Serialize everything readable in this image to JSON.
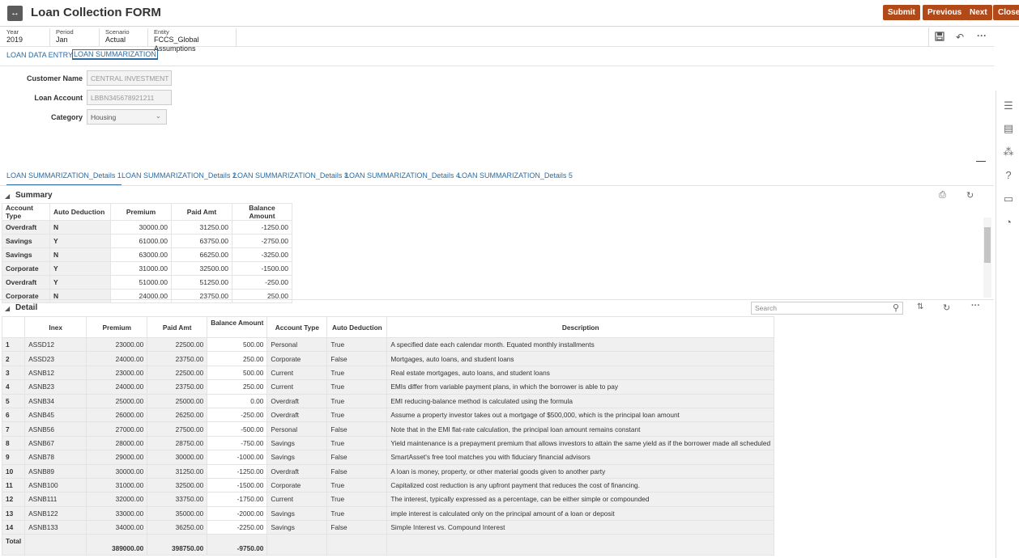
{
  "header": {
    "title": "Loan Collection FORM",
    "buttons": [
      "Submit",
      "Previous",
      "Next",
      "Close"
    ],
    "accent": "#b14a18"
  },
  "pov": [
    {
      "label": "Year",
      "value": "2019"
    },
    {
      "label": "Period",
      "value": "Jan"
    },
    {
      "label": "Scenario",
      "value": "Actual"
    },
    {
      "label": "Entity",
      "value": "FCCS_Global Assumptions"
    }
  ],
  "tabs": [
    "LOAN DATA ENTRY",
    "LOAN SUMMARIZATION"
  ],
  "form": {
    "customer_name_label": "Customer Name",
    "customer_name_value": "CENTRAL INVESTMENT E",
    "loan_account_label": "Loan Account",
    "loan_account_value": "LBBN345678921211",
    "category_label": "Category",
    "category_value": "Housing"
  },
  "subtabs": [
    "LOAN SUMMARIZATION_Details 1",
    "LOAN SUMMARIZATION_Details 2",
    "LOAN SUMMARIZATION_Details 3",
    "LOAN SUMMARIZATION_Details 4",
    "LOAN SUMMARIZATION_Details 5"
  ],
  "summary": {
    "title": "Summary",
    "headers": [
      "Account Type",
      "Auto Deduction",
      "Premium",
      "Paid Amt",
      "Balance Amount"
    ],
    "rows": [
      [
        "Overdraft",
        "N",
        "30000.00",
        "31250.00",
        "-1250.00"
      ],
      [
        "Savings",
        "Y",
        "61000.00",
        "63750.00",
        "-2750.00"
      ],
      [
        "Savings",
        "N",
        "63000.00",
        "66250.00",
        "-3250.00"
      ],
      [
        "Corporate",
        "Y",
        "31000.00",
        "32500.00",
        "-1500.00"
      ],
      [
        "Overdraft",
        "Y",
        "51000.00",
        "51250.00",
        "-250.00"
      ],
      [
        "Corporate",
        "N",
        "24000.00",
        "23750.00",
        "250.00"
      ]
    ]
  },
  "detail": {
    "title": "Detail",
    "search_placeholder": "Search",
    "headers": [
      "Inex",
      "Premium",
      "Paid Amt",
      "Balance Amount",
      "Account Type",
      "Auto Deduction",
      "Description"
    ],
    "rows": [
      [
        "1",
        "ASSD12",
        "23000.00",
        "22500.00",
        "500.00",
        "Personal",
        "True",
        "A specified date each calendar month. Equated monthly installments"
      ],
      [
        "2",
        "ASSD23",
        "24000.00",
        "23750.00",
        "250.00",
        "Corporate",
        "False",
        "Mortgages, auto loans, and student loans"
      ],
      [
        "3",
        "ASNB12",
        "23000.00",
        "22500.00",
        "500.00",
        "Current",
        "True",
        "Real estate mortgages, auto loans, and student loans"
      ],
      [
        "4",
        "ASNB23",
        "24000.00",
        "23750.00",
        "250.00",
        "Current",
        "True",
        "EMIs differ from variable payment plans, in which the borrower is able to pay"
      ],
      [
        "5",
        "ASNB34",
        "25000.00",
        "25000.00",
        "0.00",
        "Overdraft",
        "True",
        "EMI reducing-balance method is calculated using the formula"
      ],
      [
        "6",
        "ASNB45",
        "26000.00",
        "26250.00",
        "-250.00",
        "Overdraft",
        "True",
        "Assume a property investor takes out a mortgage of $500,000, which is the principal loan amount"
      ],
      [
        "7",
        "ASNB56",
        "27000.00",
        "27500.00",
        "-500.00",
        "Personal",
        "False",
        "Note that in the EMI flat-rate calculation, the principal loan amount remains constant"
      ],
      [
        "8",
        "ASNB67",
        "28000.00",
        "28750.00",
        "-750.00",
        "Savings",
        "True",
        "Yield maintenance is a prepayment premium that allows investors to attain the same yield as if the borrower made all scheduled"
      ],
      [
        "9",
        "ASNB78",
        "29000.00",
        "30000.00",
        "-1000.00",
        "Savings",
        "False",
        "SmartAsset's free tool matches you with fiduciary financial advisors"
      ],
      [
        "10",
        "ASNB89",
        "30000.00",
        "31250.00",
        "-1250.00",
        "Overdraft",
        "False",
        "A loan is money, property, or other material goods given to another party"
      ],
      [
        "11",
        "ASNB100",
        "31000.00",
        "32500.00",
        "-1500.00",
        "Corporate",
        "True",
        "Capitalized cost reduction is any upfront payment that reduces the cost of financing."
      ],
      [
        "12",
        "ASNB111",
        "32000.00",
        "33750.00",
        "-1750.00",
        "Current",
        "True",
        "The interest, typically expressed as a percentage, can be either simple or compounded"
      ],
      [
        "13",
        "ASNB122",
        "33000.00",
        "35000.00",
        "-2000.00",
        "Savings",
        "True",
        "imple interest is calculated only on the principal amount of a loan or deposit"
      ],
      [
        "14",
        "ASNB133",
        "34000.00",
        "36250.00",
        "-2250.00",
        "Savings",
        "False",
        "Simple Interest vs. Compound Interest"
      ]
    ],
    "total": [
      "Total",
      "",
      "389000.00",
      "398750.00",
      "-9750.00"
    ]
  }
}
